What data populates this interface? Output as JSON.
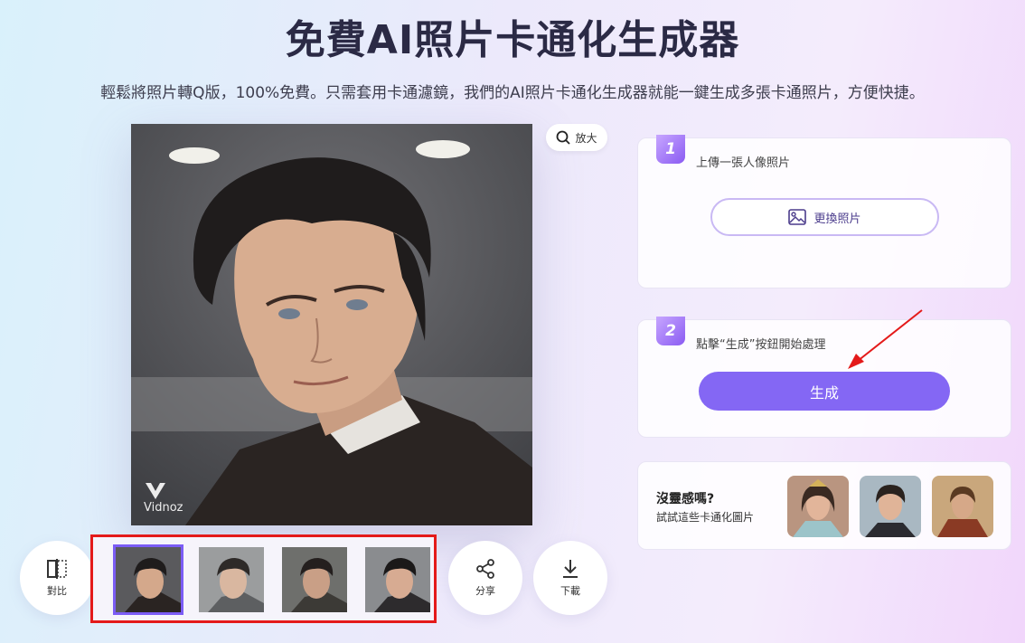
{
  "header": {
    "title": "免費AI照片卡通化生成器",
    "subtitle": "輕鬆將照片轉Q版，100%免費。只需套用卡通濾鏡，我們的AI照片卡通化生成器就能一鍵生成多張卡通照片，方便快捷。"
  },
  "preview": {
    "zoom_label": "放大",
    "watermark_text": "Vidnoz"
  },
  "toolbar": {
    "compare_label": "對比",
    "share_label": "分享",
    "download_label": "下載",
    "selected_thumb_index": 0
  },
  "steps": {
    "step1": {
      "number": "1",
      "text": "上傳一張人像照片",
      "button_label": "更換照片"
    },
    "step2": {
      "number": "2",
      "text": "點擊“生成”按鈕開始處理",
      "button_label": "生成"
    }
  },
  "examples": {
    "title": "沒靈感嗎?",
    "subtitle": "試試這些卡通化圖片"
  },
  "colors": {
    "accent": "#8467f4",
    "highlight_box": "#e41a1a",
    "arrow": "#e41a1a"
  }
}
